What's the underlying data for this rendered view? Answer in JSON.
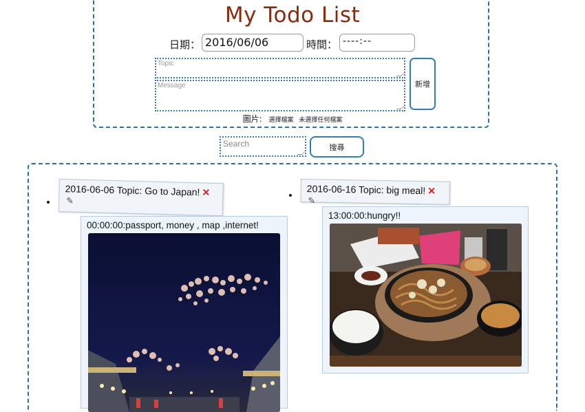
{
  "app": {
    "title": "My Todo List"
  },
  "form": {
    "date_label": "日期：",
    "date_value": "2016/06/06",
    "time_label": "時間：",
    "time_value": "----:--",
    "topic_placeholder": "Topic",
    "message_placeholder": "Message",
    "add_button": "新增",
    "image_label": "圖片:",
    "file_button": "選擇檔案",
    "file_status": "未選擇任何檔案"
  },
  "search": {
    "placeholder": "Search",
    "button": "搜尋"
  },
  "todos": [
    {
      "header": "2016-06-06 Topic: Go to Japan!",
      "message": "00:00:00:passport, money , map ,internet!",
      "image": "night-street-cherry-blossom-photo"
    },
    {
      "header": "2016-06-16 Topic: big meal!",
      "message": "13:00:00:hungry!!",
      "image": "yakisoba-meal-photo"
    }
  ],
  "icons": {
    "delete": "x-icon",
    "edit": "pencil-icon"
  },
  "colors": {
    "title": "#8a2a0a",
    "border": "#2f6ea0",
    "delete": "#e02020"
  }
}
